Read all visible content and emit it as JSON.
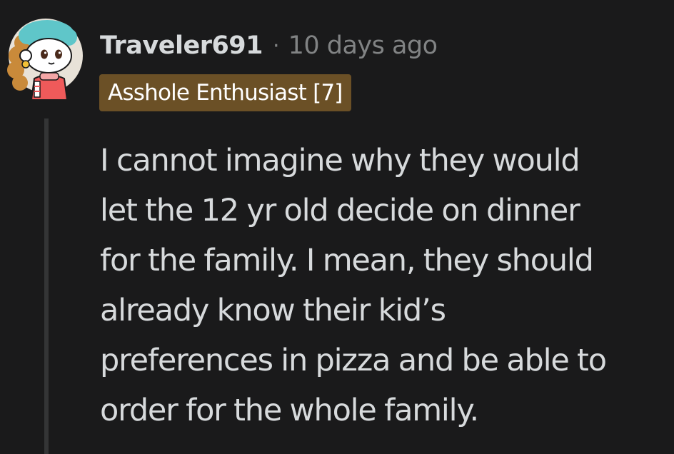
{
  "comment": {
    "author": "Traveler691",
    "separator": "·",
    "timestamp": "10 days ago",
    "flair": "Asshole Enthusiast [7]",
    "body_lines": [
      "I cannot imagine why they would",
      "let the 12 yr old decide on dinner",
      "for the family. I mean, they should",
      "already know their kid’s",
      "preferences in pizza and be able to",
      "order for the whole family."
    ]
  },
  "colors": {
    "background": "#1a1a1b",
    "text_primary": "#d7dadc",
    "text_muted": "#818384",
    "flair_bg": "#6b5026",
    "thread_line": "#343536"
  },
  "icons": {
    "avatar": "snoo-avatar-icon"
  }
}
